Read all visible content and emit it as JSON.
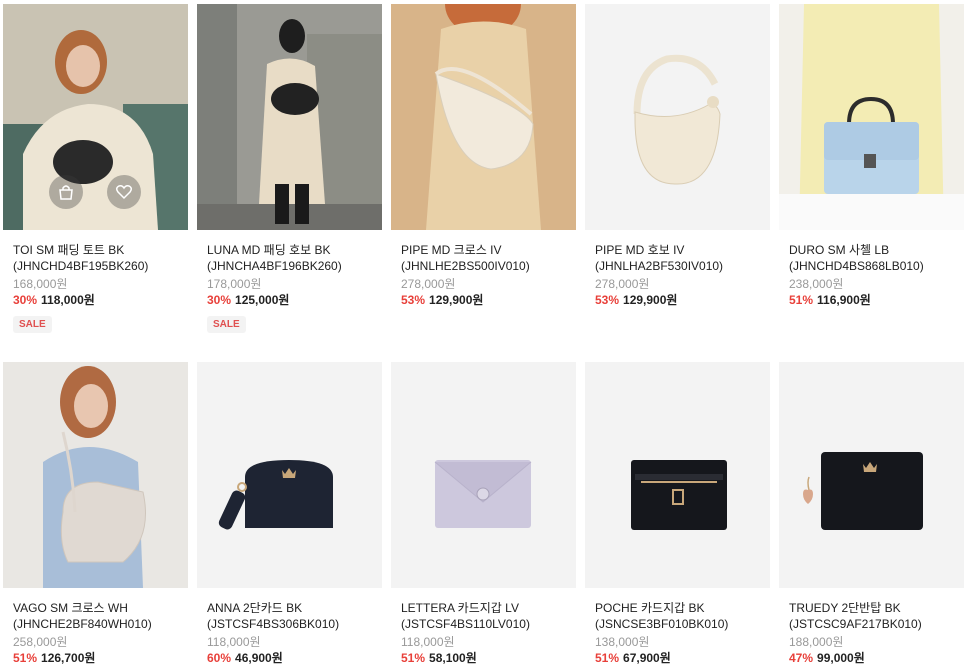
{
  "products": [
    {
      "name": "TOI SM 패딩 토트 BK",
      "code": "(JHNCHD4BF195BK260)",
      "original_price": "168,000원",
      "discount": "30%",
      "price": "118,000원",
      "badge": "SALE"
    },
    {
      "name": "LUNA MD 패딩 호보 BK",
      "code": "(JHNCHA4BF196BK260)",
      "original_price": "178,000원",
      "discount": "30%",
      "price": "125,000원",
      "badge": "SALE"
    },
    {
      "name": "PIPE MD 크로스 IV",
      "code": "(JHNLHE2BS500IV010)",
      "original_price": "278,000원",
      "discount": "53%",
      "price": "129,900원"
    },
    {
      "name": "PIPE MD 호보 IV",
      "code": "(JHNLHA2BF530IV010)",
      "original_price": "278,000원",
      "discount": "53%",
      "price": "129,900원"
    },
    {
      "name": "DURO SM 사첼 LB",
      "code": "(JHNCHD4BS868LB010)",
      "original_price": "238,000원",
      "discount": "51%",
      "price": "116,900원"
    },
    {
      "name": "VAGO SM 크로스 WH",
      "code": "(JHNCHE2BF840WH010)",
      "original_price": "258,000원",
      "discount": "51%",
      "price": "126,700원"
    },
    {
      "name": "ANNA 2단카드 BK",
      "code": "(JSTCSF4BS306BK010)",
      "original_price": "118,000원",
      "discount": "60%",
      "price": "46,900원"
    },
    {
      "name": "LETTERA 카드지갑 LV",
      "code": "(JSTCSF4BS110LV010)",
      "original_price": "118,000원",
      "discount": "51%",
      "price": "58,100원"
    },
    {
      "name": "POCHE 카드지갑 BK",
      "code": "(JSNCSE3BF010BK010)",
      "original_price": "138,000원",
      "discount": "51%",
      "price": "67,900원"
    },
    {
      "name": "TRUEDY 2단반탑 BK",
      "code": "(JSTCSC9AF217BK010)",
      "original_price": "188,000원",
      "discount": "47%",
      "price": "99,000원"
    }
  ],
  "colors": {
    "discount": "#e8403a",
    "original": "#999999",
    "sale_badge_text": "#e05050"
  },
  "icons": {
    "cart": "bag-plus-icon",
    "wishlist": "heart-icon"
  }
}
